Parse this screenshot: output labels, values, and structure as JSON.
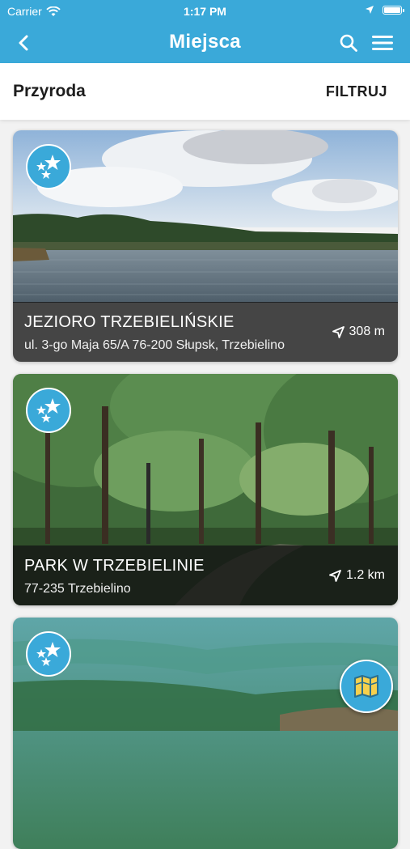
{
  "status_bar": {
    "carrier": "Carrier",
    "time": "1:17 PM"
  },
  "nav": {
    "title": "Miejsca"
  },
  "subheader": {
    "category": "Przyroda",
    "filter_label": "FILTRUJ"
  },
  "places": [
    {
      "name": "JEZIORO TRZEBIELIŃSKIE",
      "address": "ul. 3-go Maja 65/A 76-200 Słupsk,  Trzebielino",
      "distance": "308 m",
      "image": "lake-photo"
    },
    {
      "name": "PARK W TRZEBIELINIE",
      "address": "77-235 Trzebielino",
      "distance": "1.2 km",
      "image": "park-photo"
    },
    {
      "name": "",
      "address": "",
      "distance": "",
      "image": "forest-aerial-photo"
    }
  ],
  "icons": [
    "back-icon",
    "search-icon",
    "menu-icon",
    "stars-icon",
    "location-arrow-icon",
    "map-icon"
  ],
  "colors": {
    "accent": "#3aa9d9"
  }
}
